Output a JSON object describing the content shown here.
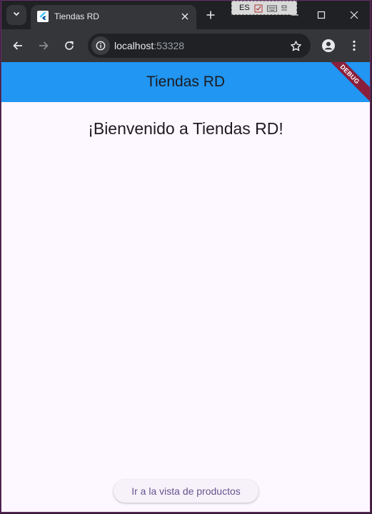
{
  "browser": {
    "tab": {
      "title": "Tiendas RD",
      "favicon": "flutter-icon"
    },
    "ime": {
      "language": "ES"
    },
    "address_bar": {
      "host": "localhost",
      "port": ":53328"
    }
  },
  "app": {
    "appbar_title": "Tiendas RD",
    "debug_banner": "DEBUG",
    "welcome_text": "¡Bienvenido a Tiendas RD!",
    "products_button_label": "Ir a la vista de productos"
  },
  "colors": {
    "appbar": "#2196f3",
    "page_background": "#fdf7ff",
    "button_text": "#65558f",
    "debug_banner": "#8a1f3c"
  }
}
